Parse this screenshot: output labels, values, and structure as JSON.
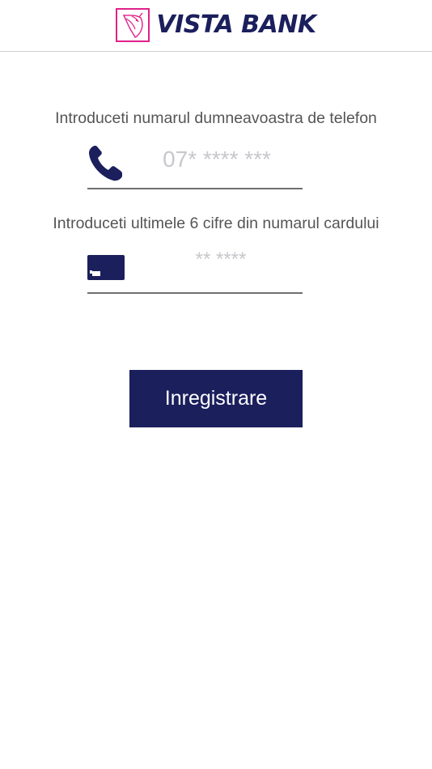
{
  "header": {
    "brand_name": "VISTA BANK",
    "logo_icon": "horse-head-logo",
    "brand_color": "#1b1f5c",
    "logo_accent_color": "#e0218a"
  },
  "form": {
    "phone_label": "Introduceti numarul dumneavoastra de telefon",
    "phone_placeholder": "07* **** ***",
    "phone_icon": "phone-icon",
    "card_label": "Introduceti ultimele 6 cifre din numarul cardului",
    "card_placeholder": "** ****",
    "card_icon": "credit-card-icon",
    "submit_label": "Inregistrare",
    "accent_color": "#1b1f5c"
  }
}
